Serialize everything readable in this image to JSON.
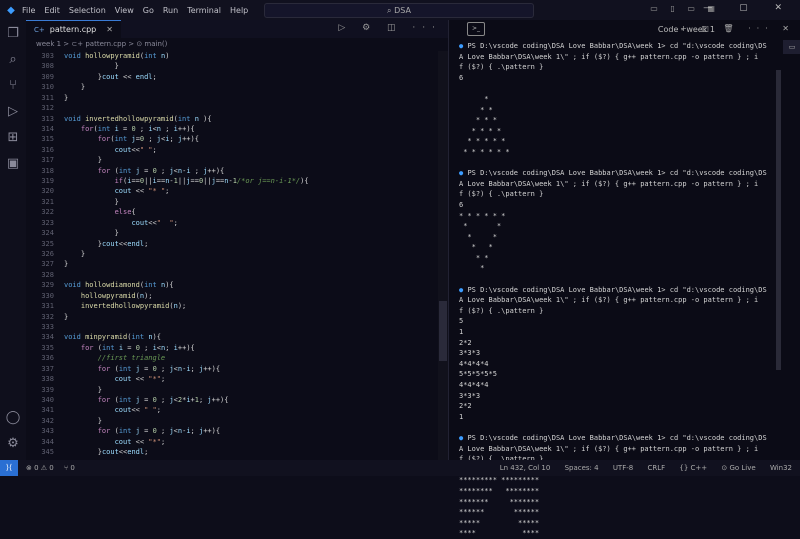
{
  "menu": [
    "File",
    "Edit",
    "Selection",
    "View",
    "Go",
    "Run",
    "Terminal",
    "Help"
  ],
  "search": {
    "text": "DSA"
  },
  "editor": {
    "tab_label": "pattern.cpp",
    "breadcrumb": "week 1 > ⊂+ pattern.cpp > ⊙ main()",
    "lines": [
      {
        "n": "303",
        "html": "<span class='ty'>void</span> <span class='fn'>hollowpyramid</span>(<span class='ty'>int</span> <span class='va'>n</span>)"
      },
      {
        "n": "308",
        "html": "            }"
      },
      {
        "n": "309",
        "html": "        }<span class='va'>cout</span> &lt;&lt; <span class='va'>endl</span>;"
      },
      {
        "n": "310",
        "html": "    }"
      },
      {
        "n": "311",
        "html": "}"
      },
      {
        "n": "312",
        "html": ""
      },
      {
        "n": "313",
        "html": "<span class='ty'>void</span> <span class='fn'>invertedhollowpyramid</span>(<span class='ty'>int</span> <span class='va'>n</span> ){"
      },
      {
        "n": "314",
        "html": "    <span class='kw'>for</span>(<span class='ty'>int</span> <span class='va'>i</span> = <span class='nm'>0</span> ; <span class='va'>i</span>&lt;<span class='va'>n</span> ; <span class='va'>i</span>++){"
      },
      {
        "n": "315",
        "html": "        <span class='kw'>for</span>(<span class='ty'>int</span> <span class='va'>j</span>=<span class='nm'>0</span> ; <span class='va'>j</span>&lt;<span class='va'>i</span>; <span class='va'>j</span>++){"
      },
      {
        "n": "316",
        "html": "            <span class='va'>cout</span>&lt;&lt;<span class='st'>\" \"</span>;"
      },
      {
        "n": "317",
        "html": "        }"
      },
      {
        "n": "318",
        "html": "        <span class='kw'>for</span> (<span class='ty'>int</span> <span class='va'>j</span> = <span class='nm'>0</span> ; <span class='va'>j</span>&lt;<span class='va'>n</span>-<span class='va'>i</span> ; <span class='va'>j</span>++){"
      },
      {
        "n": "319",
        "html": "            <span class='kw'>if</span>(<span class='va'>i</span>==<span class='nm'>0</span>||<span class='va'>i</span>==<span class='va'>n</span>-<span class='nm'>1</span>||<span class='va'>j</span>==<span class='nm'>0</span>||<span class='va'>j</span>==<span class='va'>n</span>-<span class='nm'>1</span><span class='cm'>/*or j==n-i-1*/</span>){"
      },
      {
        "n": "320",
        "html": "            <span class='va'>cout</span> &lt;&lt; <span class='st'>\"* \"</span>;"
      },
      {
        "n": "321",
        "html": "            }"
      },
      {
        "n": "322",
        "html": "            <span class='kw'>else</span>{"
      },
      {
        "n": "323",
        "html": "                <span class='va'>cout</span>&lt;&lt;<span class='st'>\"  \"</span>;"
      },
      {
        "n": "324",
        "html": "            }"
      },
      {
        "n": "325",
        "html": "        }<span class='va'>cout</span>&lt;&lt;<span class='va'>endl</span>;"
      },
      {
        "n": "326",
        "html": "    }"
      },
      {
        "n": "327",
        "html": "}"
      },
      {
        "n": "328",
        "html": ""
      },
      {
        "n": "329",
        "html": "<span class='ty'>void</span> <span class='fn'>hollowdiamond</span>(<span class='ty'>int</span> <span class='va'>n</span>){"
      },
      {
        "n": "330",
        "html": "    <span class='fn'>hollowpyramid</span>(<span class='va'>n</span>);"
      },
      {
        "n": "331",
        "html": "    <span class='fn'>invertedhollowpyramid</span>(<span class='va'>n</span>);"
      },
      {
        "n": "332",
        "html": "}"
      },
      {
        "n": "333",
        "html": ""
      },
      {
        "n": "334",
        "html": "<span class='ty'>void</span> <span class='fn'>minpyramid</span>(<span class='ty'>int</span> <span class='va'>n</span>){"
      },
      {
        "n": "335",
        "html": "    <span class='kw'>for</span> (<span class='ty'>int</span> <span class='va'>i</span> = <span class='nm'>0</span> ; <span class='va'>i</span>&lt;<span class='va'>n</span>; <span class='va'>i</span>++){"
      },
      {
        "n": "336",
        "html": "        <span class='cm'>//first triangle</span>"
      },
      {
        "n": "337",
        "html": "        <span class='kw'>for</span> (<span class='ty'>int</span> <span class='va'>j</span> = <span class='nm'>0</span> ; <span class='va'>j</span>&lt;<span class='va'>n</span>-<span class='va'>i</span>; <span class='va'>j</span>++){"
      },
      {
        "n": "338",
        "html": "            <span class='va'>cout</span> &lt;&lt; <span class='st'>\"*\"</span>;"
      },
      {
        "n": "339",
        "html": "        }"
      },
      {
        "n": "340",
        "html": "        <span class='kw'>for</span> (<span class='ty'>int</span> <span class='va'>j</span> = <span class='nm'>0</span> ; <span class='va'>j</span>&lt;<span class='nm'>2</span>*<span class='va'>i</span>+<span class='nm'>1</span>; <span class='va'>j</span>++){"
      },
      {
        "n": "341",
        "html": "            <span class='va'>cout</span>&lt;&lt; <span class='st'>\" \"</span>;"
      },
      {
        "n": "342",
        "html": "        }"
      },
      {
        "n": "343",
        "html": "        <span class='kw'>for</span> (<span class='ty'>int</span> <span class='va'>j</span> = <span class='nm'>0</span> ; <span class='va'>j</span>&lt;<span class='va'>n</span>-<span class='va'>i</span>; <span class='va'>j</span>++){"
      },
      {
        "n": "344",
        "html": "            <span class='va'>cout</span> &lt;&lt; <span class='st'>\"*\"</span>;"
      },
      {
        "n": "345",
        "html": "        }<span class='va'>cout</span>&lt;&lt;<span class='va'>endl</span>;"
      }
    ]
  },
  "panel": {
    "terminal_name": "Code - week 1"
  },
  "terminal": {
    "lines": [
      {
        "t": "prompt",
        "text": "PS D:\\vscode coding\\DSA Love Babbar\\DSA\\week 1> cd \"d:\\vscode coding\\DS"
      },
      {
        "t": "plain",
        "text": "A Love Babbar\\DSA\\week 1\\\" ; if ($?) { g++ pattern.cpp -o pattern } ; i"
      },
      {
        "t": "pat",
        "text": "f ($?) { .\\pattern }"
      },
      {
        "t": "plain",
        "text": "6"
      },
      {
        "t": "plain",
        "text": ""
      },
      {
        "t": "plain",
        "text": "      *"
      },
      {
        "t": "plain",
        "text": "     * *"
      },
      {
        "t": "plain",
        "text": "    * * *"
      },
      {
        "t": "plain",
        "text": "   * * * *"
      },
      {
        "t": "plain",
        "text": "  * * * * *"
      },
      {
        "t": "plain",
        "text": " * * * * * *"
      },
      {
        "t": "gap",
        "text": ""
      },
      {
        "t": "prompt",
        "text": "PS D:\\vscode coding\\DSA Love Babbar\\DSA\\week 1> cd \"d:\\vscode coding\\DS"
      },
      {
        "t": "plain",
        "text": "A Love Babbar\\DSA\\week 1\\\" ; if ($?) { g++ pattern.cpp -o pattern } ; i"
      },
      {
        "t": "pat",
        "text": "f ($?) { .\\pattern }"
      },
      {
        "t": "plain",
        "text": "6"
      },
      {
        "t": "plain",
        "text": "* * * * * *"
      },
      {
        "t": "plain",
        "text": " *       *"
      },
      {
        "t": "plain",
        "text": "  *     *"
      },
      {
        "t": "plain",
        "text": "   *   *"
      },
      {
        "t": "plain",
        "text": "    * *"
      },
      {
        "t": "plain",
        "text": "     *"
      },
      {
        "t": "gap",
        "text": ""
      },
      {
        "t": "prompt",
        "text": "PS D:\\vscode coding\\DSA Love Babbar\\DSA\\week 1> cd \"d:\\vscode coding\\DS"
      },
      {
        "t": "plain",
        "text": "A Love Babbar\\DSA\\week 1\\\" ; if ($?) { g++ pattern.cpp -o pattern } ; i"
      },
      {
        "t": "pat",
        "text": "f ($?) { .\\pattern }"
      },
      {
        "t": "plain",
        "text": "5"
      },
      {
        "t": "plain",
        "text": "1"
      },
      {
        "t": "plain",
        "text": "2*2"
      },
      {
        "t": "plain",
        "text": "3*3*3"
      },
      {
        "t": "plain",
        "text": "4*4*4*4"
      },
      {
        "t": "plain",
        "text": "5*5*5*5*5"
      },
      {
        "t": "plain",
        "text": "4*4*4*4"
      },
      {
        "t": "plain",
        "text": "3*3*3"
      },
      {
        "t": "plain",
        "text": "2*2"
      },
      {
        "t": "plain",
        "text": "1"
      },
      {
        "t": "gap",
        "text": ""
      },
      {
        "t": "prompt",
        "text": "PS D:\\vscode coding\\DSA Love Babbar\\DSA\\week 1> cd \"d:\\vscode coding\\DS"
      },
      {
        "t": "plain",
        "text": "A Love Babbar\\DSA\\week 1\\\" ; if ($?) { g++ pattern.cpp -o pattern } ; i"
      },
      {
        "t": "pat",
        "text": "f ($?) { .\\pattern }"
      },
      {
        "t": "plain",
        "text": "9"
      },
      {
        "t": "plain",
        "text": "********* *********"
      },
      {
        "t": "plain",
        "text": "********   ********"
      },
      {
        "t": "plain",
        "text": "*******     *******"
      },
      {
        "t": "plain",
        "text": "******       ******"
      },
      {
        "t": "plain",
        "text": "*****         *****"
      },
      {
        "t": "plain",
        "text": "****           ****"
      }
    ]
  },
  "status": {
    "errors": "⊗ 0 ⚠ 0",
    "ports": "⑂ 0",
    "position": "Ln 432, Col 10",
    "spaces": "Spaces: 4",
    "encoding": "UTF-8",
    "eol": "CRLF",
    "language": "{} C++",
    "golive": "⊙ Go Live",
    "platform": "Win32"
  }
}
